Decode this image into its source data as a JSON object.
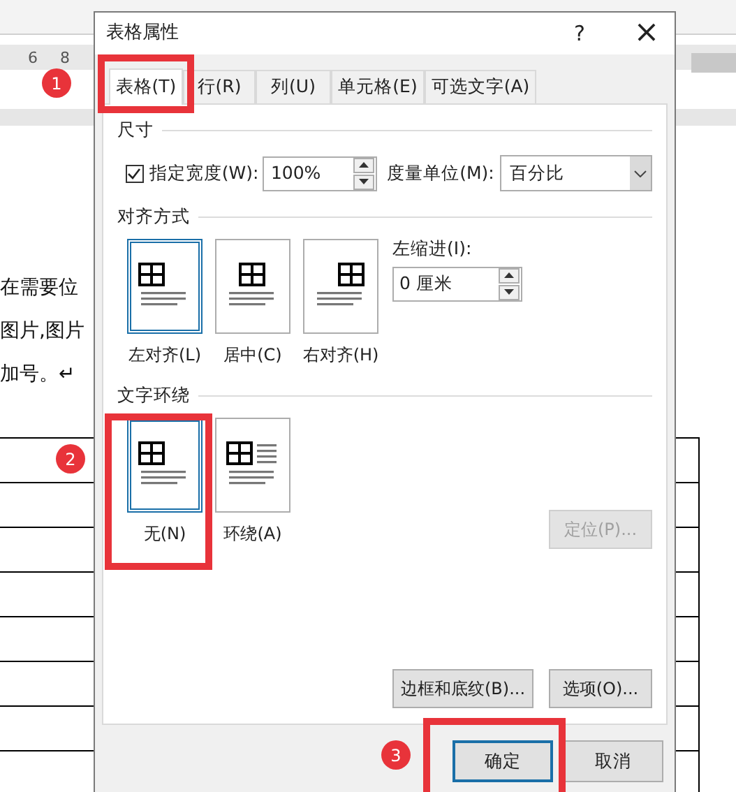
{
  "document": {
    "ruler_numbers": [
      "6",
      "8"
    ],
    "paragraph_lines": [
      "在需要位",
      "图片,图片",
      "加号。↵"
    ]
  },
  "dialog": {
    "title": "表格属性",
    "help": "?",
    "close": "×",
    "tabs": [
      {
        "label": "表格(T)",
        "selected": true
      },
      {
        "label": "行(R)",
        "selected": false
      },
      {
        "label": "列(U)",
        "selected": false
      },
      {
        "label": "单元格(E)",
        "selected": false
      },
      {
        "label": "可选文字(A)",
        "selected": false
      }
    ],
    "size_section": {
      "heading": "尺寸",
      "specify_width": {
        "label": "指定宽度(W):",
        "checked": true
      },
      "width_value": "100%",
      "unit_label": "度量单位(M):",
      "unit_value": "百分比"
    },
    "alignment_section": {
      "heading": "对齐方式",
      "options": [
        {
          "label": "左对齐(L)",
          "selected": true,
          "kind": "left"
        },
        {
          "label": "居中(C)",
          "selected": false,
          "kind": "center"
        },
        {
          "label": "右对齐(H)",
          "selected": false,
          "kind": "right"
        }
      ],
      "indent_label": "左缩进(I):",
      "indent_value": "0 厘米"
    },
    "wrap_section": {
      "heading": "文字环绕",
      "options": [
        {
          "label": "无(N)",
          "selected": true,
          "kind": "none"
        },
        {
          "label": "环绕(A)",
          "selected": false,
          "kind": "around"
        }
      ],
      "position_button": {
        "label": "定位(P)...",
        "disabled": true
      }
    },
    "panel_buttons": [
      {
        "label": "边框和底纹(B)..."
      },
      {
        "label": "选项(O)..."
      }
    ],
    "footer_buttons": [
      {
        "label": "确定",
        "default": true
      },
      {
        "label": "取消",
        "default": false
      }
    ]
  },
  "annotations": [
    {
      "number": "1"
    },
    {
      "number": "2"
    },
    {
      "number": "3"
    }
  ]
}
